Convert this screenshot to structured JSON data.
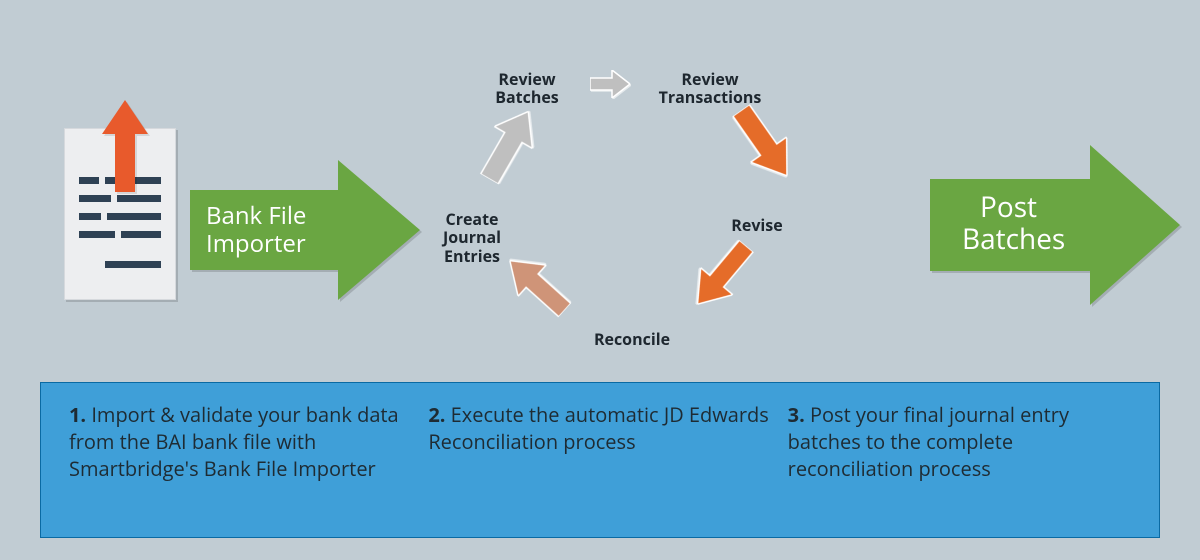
{
  "arrow1_line1": "Bank File",
  "arrow1_line2": "Importer",
  "arrow2_line1": "Post",
  "arrow2_line2": "Batches",
  "cycle": {
    "review_batches_l1": "Review",
    "review_batches_l2": "Batches",
    "review_transactions_l1": "Review",
    "review_transactions_l2": "Transactions",
    "revise": "Revise",
    "reconcile": "Reconcile",
    "create_je_l1": "Create",
    "create_je_l2": "Journal",
    "create_je_l3": "Entries"
  },
  "foot1_num": "1.",
  "foot1_text": " Import & validate your bank data from the BAI bank file with Smartbridge's Bank File Importer",
  "foot2_num": "2.",
  "foot2_text": " Execute the automatic JD Edwards Reconciliation process",
  "foot3_num": "3.",
  "foot3_text": " Post your final journal entry batches to the complete reconciliation process"
}
